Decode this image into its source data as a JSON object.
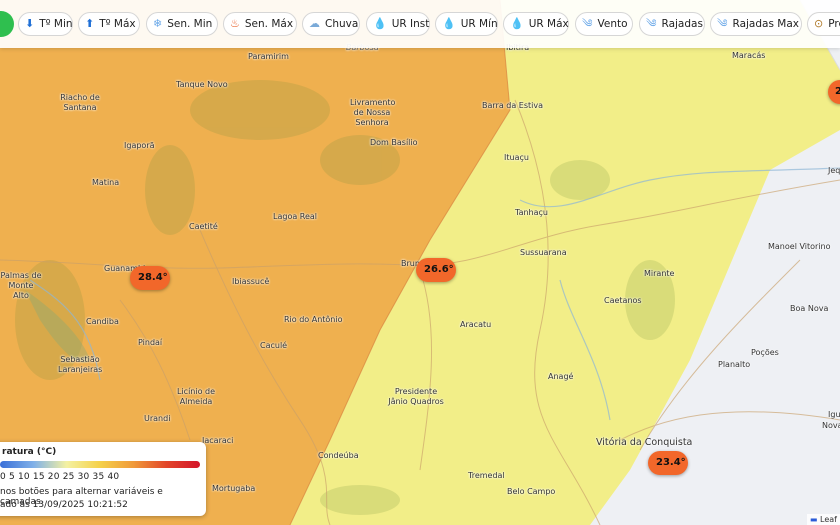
{
  "toolbar": {
    "items": [
      {
        "label": "Tº Min",
        "icon": "down-arrow-icon"
      },
      {
        "label": "Tº Máx",
        "icon": "up-arrow-icon"
      },
      {
        "label": "Sen. Min",
        "icon": "snowflake-icon"
      },
      {
        "label": "Sen. Máx",
        "icon": "fire-icon"
      },
      {
        "label": "Chuva",
        "icon": "rain-cloud-icon"
      },
      {
        "label": "UR Inst",
        "icon": "droplet-icon"
      },
      {
        "label": "UR Mín",
        "icon": "droplet-icon"
      },
      {
        "label": "UR Máx",
        "icon": "droplet-icon"
      },
      {
        "label": "Vento",
        "icon": "wind-icon"
      },
      {
        "label": "Rajadas",
        "icon": "wind-icon"
      },
      {
        "label": "Rajadas Max",
        "icon": "wind-icon"
      },
      {
        "label": "Pre",
        "icon": "pressure-gauge-icon"
      }
    ]
  },
  "map": {
    "places": [
      "Barbosa",
      "Paramirim",
      "Ibitira",
      "Maracás",
      "Riacho de Santana",
      "Tanque Novo",
      "Livramento de Nossa Senhora",
      "Barra da Estiva",
      "Igaporã",
      "Dom Basílio",
      "Ituaçu",
      "Matina",
      "Caetité",
      "Lagoa Real",
      "Tanhaçu",
      "Manoel Vitorino",
      "Jeq",
      "Palmas de Monte Alto",
      "Guanambi",
      "Ibiassucê",
      "Brumado",
      "Sussuarana",
      "Mirante",
      "Caetanos",
      "Boa Nova",
      "Candiba",
      "Pindaí",
      "Caculé",
      "Rio do Antônio",
      "Aracatu",
      "Poções",
      "Sebastião Laranjeiras",
      "Licínio de Almeida",
      "Anagé",
      "Planalto",
      "Urandi",
      "Presidente Jânio Quadros",
      "Iguaí",
      "Nova Canaã",
      "Jacaraci",
      "Condeúba",
      "Vitória da Conquista",
      "Mortugaba",
      "Tremedal",
      "Belo Campo"
    ],
    "temperature_markers": [
      "28.4°",
      "26.6°",
      "23.4°",
      "2"
    ]
  },
  "legend": {
    "title": "ratura (°C)",
    "scale": "0 5 10 15 20 25 30 35 40",
    "hint": "nos botões para alternar variáveis e camadas.",
    "updated": "ado às 13/09/2025 10:21:52"
  },
  "attribution": "Leaf",
  "colors": {
    "warm_zone": "#f0b450",
    "mild_zone": "#f3ee86",
    "cool_zone": "#eef0f4",
    "marker": "#f2672a",
    "status_green": "#2fbf4f"
  }
}
